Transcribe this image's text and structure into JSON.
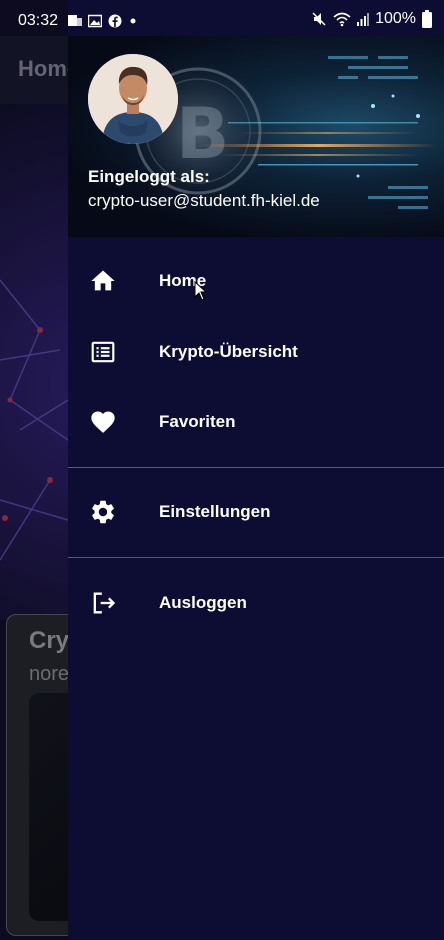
{
  "status_bar": {
    "time": "03:32",
    "battery_text": "100%",
    "left_icons": [
      "teams-notification-icon",
      "gallery-notification-icon",
      "facebook-notification-icon",
      "dot-icon"
    ],
    "right_icons": [
      "mute-icon",
      "wifi-icon",
      "signal-icon",
      "battery-icon"
    ]
  },
  "background_app": {
    "title": "Home",
    "card_title": "Cry",
    "card_subtitle": "nore"
  },
  "drawer": {
    "logged_in_label": "Eingeloggt als:",
    "user_email": "crypto-user@student.fh-kiel.de",
    "items": [
      {
        "label": "Home",
        "icon": "home-icon"
      },
      {
        "label": "Krypto-Übersicht",
        "icon": "list-icon"
      },
      {
        "label": "Favoriten",
        "icon": "heart-icon"
      },
      {
        "label": "Einstellungen",
        "icon": "gear-icon"
      },
      {
        "label": "Ausloggen",
        "icon": "logout-icon"
      }
    ]
  },
  "colors": {
    "drawer_background": "#0d0c33",
    "text": "#ffffff",
    "divider": "#5a5a78"
  }
}
